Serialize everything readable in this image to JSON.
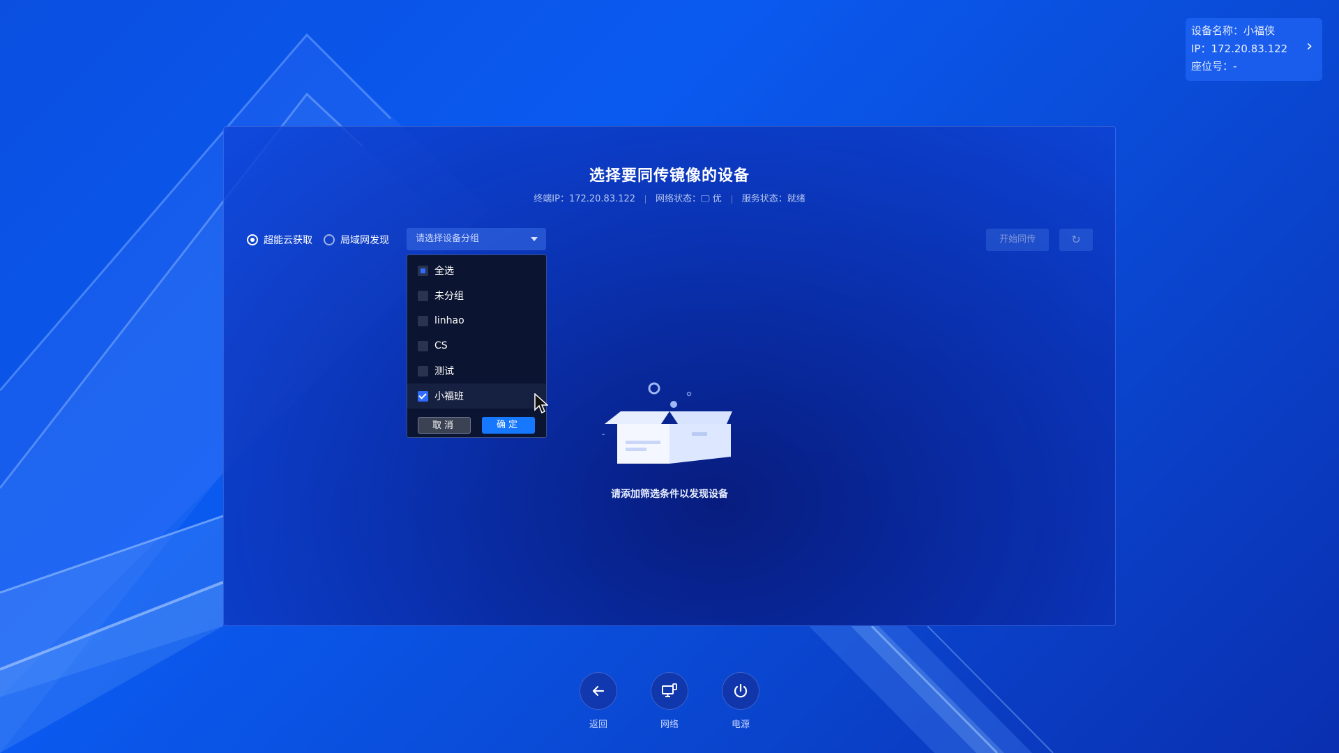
{
  "device_info": {
    "name_line": "设备名称：小福侠",
    "ip_line": "IP：172.20.83.122",
    "seat_line": "座位号：-"
  },
  "panel": {
    "title": "选择要同传镜像的设备",
    "terminal_ip": "终端IP：172.20.83.122",
    "network_status": "网络状态：🖵 优",
    "service_status": "服务状态：就绪"
  },
  "source": {
    "options": [
      {
        "label": "超能云获取",
        "checked": true
      },
      {
        "label": "局域网发现",
        "checked": false
      }
    ]
  },
  "group_select": {
    "placeholder": "请选择设备分组"
  },
  "toolbar": {
    "start_label": "开始同传",
    "refresh_icon": "refresh-icon"
  },
  "dropdown": {
    "items": [
      {
        "label": "全选",
        "state": "partial"
      },
      {
        "label": "未分组",
        "state": "unchecked"
      },
      {
        "label": "linhao",
        "state": "unchecked"
      },
      {
        "label": "CS",
        "state": "unchecked"
      },
      {
        "label": "测试",
        "state": "unchecked"
      },
      {
        "label": "小福班",
        "state": "checked"
      }
    ],
    "cancel_label": "取消",
    "ok_label": "确定"
  },
  "empty_state": {
    "text": "请添加筛选条件以发现设备"
  },
  "nav": {
    "back_label": "返回",
    "network_label": "网络",
    "power_label": "电源"
  },
  "colors": {
    "accent": "#1677ff",
    "background": "#0a4fe0"
  }
}
